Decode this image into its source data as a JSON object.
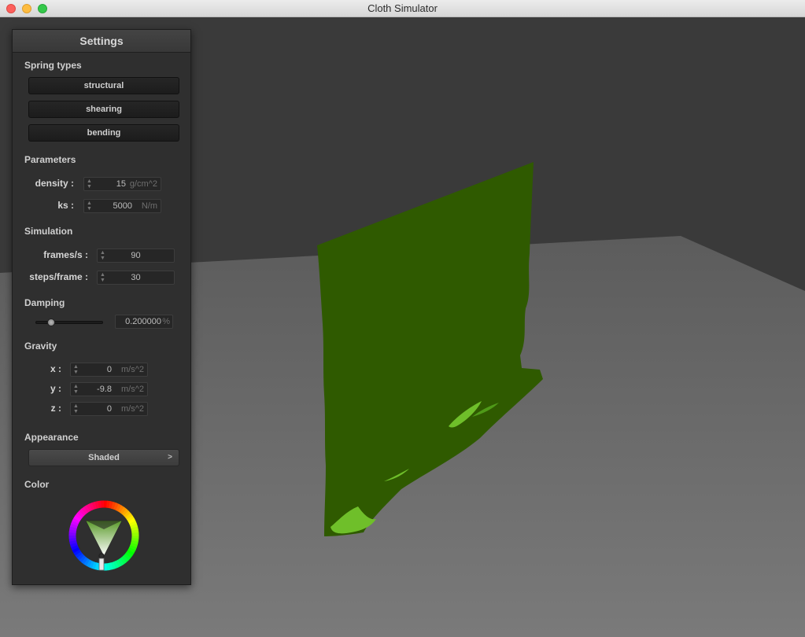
{
  "window": {
    "title": "Cloth Simulator"
  },
  "panel": {
    "title": "Settings",
    "spring_types": {
      "heading": "Spring types",
      "buttons": [
        "structural",
        "shearing",
        "bending"
      ]
    },
    "parameters": {
      "heading": "Parameters",
      "density": {
        "label": "density :",
        "value": "15",
        "unit": "g/cm^2"
      },
      "ks": {
        "label": "ks :",
        "value": "5000",
        "unit": "N/m"
      }
    },
    "simulation": {
      "heading": "Simulation",
      "fps": {
        "label": "frames/s :",
        "value": "90"
      },
      "steps": {
        "label": "steps/frame :",
        "value": "30"
      }
    },
    "damping": {
      "heading": "Damping",
      "value": "0.200000",
      "unit": "%",
      "slider_level": 0.2
    },
    "gravity": {
      "heading": "Gravity",
      "x": {
        "label": "x :",
        "value": "0",
        "unit": "m/s^2"
      },
      "y": {
        "label": "y :",
        "value": "-9.8",
        "unit": "m/s^2"
      },
      "z": {
        "label": "z :",
        "value": "0",
        "unit": "m/s^2"
      }
    },
    "appearance": {
      "heading": "Appearance",
      "selected": "Shaded",
      "chevron": ">"
    },
    "color": {
      "heading": "Color",
      "selected_color": "#4a8a1e"
    }
  },
  "scene": {
    "cloth_color": "#2f5a00",
    "cloth_highlight": "#6fbf2a",
    "ground_color": "#6e6e6e",
    "background_color": "#3a3a3a"
  }
}
